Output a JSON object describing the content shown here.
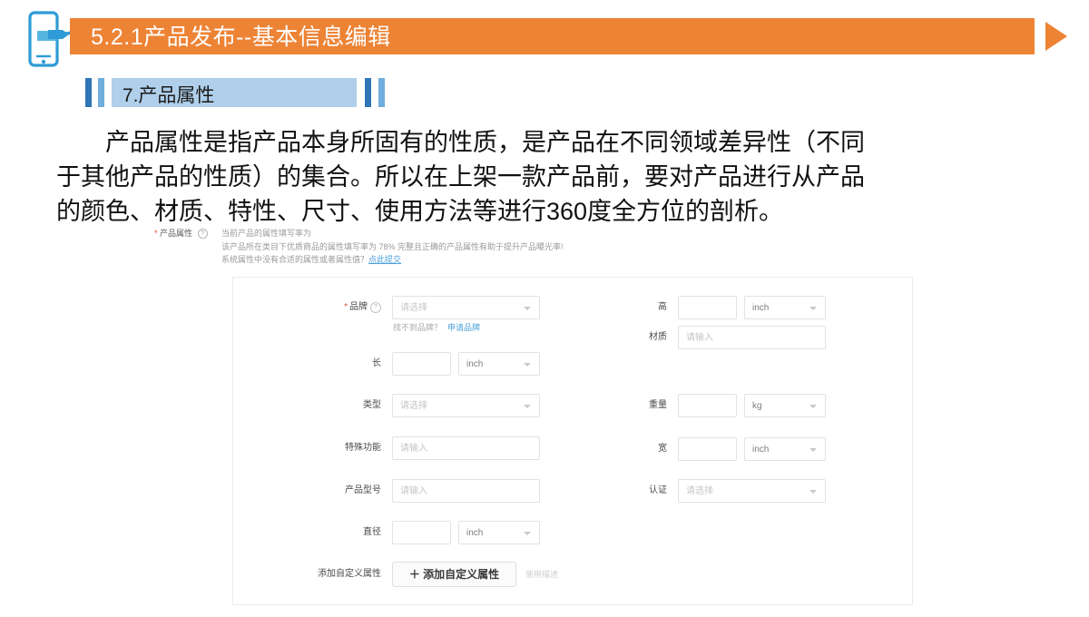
{
  "header": {
    "title": "5.2.1产品发布--基本信息编辑",
    "bar_color": "#ED8335",
    "icon": "phone-hand-icon",
    "arrow": "play-arrow-icon"
  },
  "section": {
    "heading": "7.产品属性",
    "band_color": "#AFCFEA",
    "bar_dark_color": "#2E75B6",
    "bar_light_color": "#6FAEDD"
  },
  "paragraph": {
    "line1": "产品属性是指产品本身所固有的性质，是产品在不同领域差异性（不同",
    "line2": "于其他产品的性质）的集合。所以在上架一款产品前，要对产品进行从产品",
    "line3": "的颜色、材质、特性、尺寸、使用方法等进行360度全方位的剖析。"
  },
  "notice": {
    "required_mark": "*",
    "label": "产品属性",
    "help_icon": "question-mark-icon",
    "line1": "当前产品的属性填写率为",
    "line2": "该产品所在类目下优质商品的属性填写率为 78% 完整且正确的产品属性有助于提升产品曝光率!",
    "line3_text": "系统属性中没有合适的属性或者属性值？",
    "line3_link": "点此提交",
    "fill_rate": "78%",
    "link_color": "#4a9fd8"
  },
  "form": {
    "left_column": [
      {
        "label": "品牌",
        "required": true,
        "help_icon": "question-mark-icon",
        "control": "select",
        "placeholder": "请选择",
        "sub_note": "找不到品牌？",
        "sub_link": "申请品牌"
      },
      {
        "label": "长",
        "required": false,
        "control": "input-with-unit",
        "placeholder": "",
        "unit": "inch"
      },
      {
        "label": "类型",
        "required": false,
        "control": "select",
        "placeholder": "请选择"
      },
      {
        "label": "特殊功能",
        "required": false,
        "control": "input",
        "placeholder": "请输入"
      },
      {
        "label": "产品型号",
        "required": false,
        "control": "input",
        "placeholder": "请输入"
      },
      {
        "label": "直径",
        "required": false,
        "control": "input-with-unit",
        "placeholder": "",
        "unit": "inch"
      }
    ],
    "right_column": [
      {
        "label": "高",
        "required": false,
        "control": "input-with-unit",
        "placeholder": "",
        "unit": "inch"
      },
      {
        "label": "材质",
        "required": false,
        "control": "input",
        "placeholder": "请输入"
      },
      {
        "label": "重量",
        "required": false,
        "control": "input-with-unit",
        "placeholder": "",
        "unit": "kg"
      },
      {
        "label": "宽",
        "required": false,
        "control": "input-with-unit",
        "placeholder": "",
        "unit": "inch"
      },
      {
        "label": "认证",
        "required": false,
        "control": "select",
        "placeholder": "请选择"
      }
    ],
    "custom_attribute": {
      "label": "添加自定义属性",
      "button": "＋ 添加自定义属性",
      "note": "使用描述"
    }
  }
}
